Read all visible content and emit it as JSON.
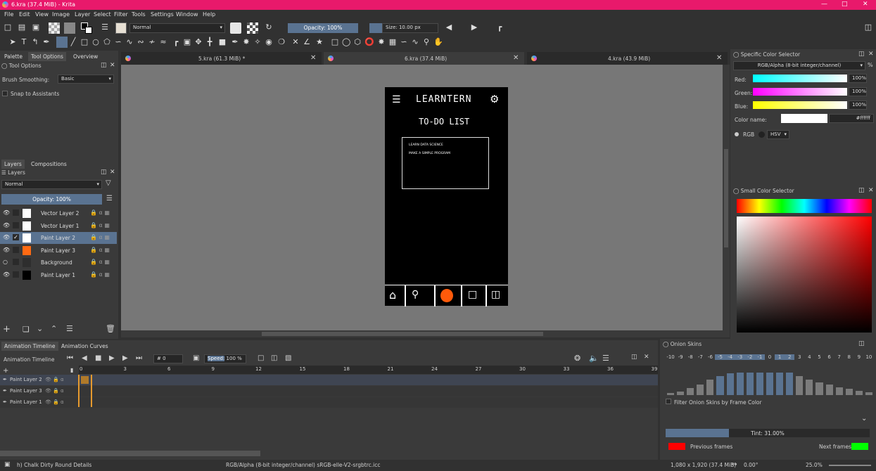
{
  "window": {
    "title": "6.kra (37.4 MiB)  - Krita"
  },
  "menu": [
    "File",
    "Edit",
    "View",
    "Image",
    "Layer",
    "Select",
    "Filter",
    "Tools",
    "Settings",
    "Window",
    "Help"
  ],
  "toolbar": {
    "blend_mode": "Normal",
    "opacity": "Opacity: 100%",
    "size": "Size: 10.00 px"
  },
  "left_tabs": [
    "Palette",
    "Tool Options",
    "Overview"
  ],
  "tool_options": {
    "title": "Tool Options",
    "brush_smoothing_label": "Brush Smoothing:",
    "brush_smoothing_value": "Basic",
    "snap_label": "Snap to Assistants"
  },
  "layers_tabs": [
    "Layers",
    "Compositions"
  ],
  "layers": {
    "title": "Layers",
    "blend": "Normal",
    "opacity": "Opacity:  100%",
    "items": [
      {
        "name": "Vector Layer 2",
        "thumb": "#ffffff",
        "selected": false,
        "visible": true
      },
      {
        "name": "Vector Layer 1",
        "thumb": "#ffffff",
        "selected": false,
        "visible": true
      },
      {
        "name": "Paint Layer 2",
        "thumb": "#ffffff",
        "selected": true,
        "visible": true
      },
      {
        "name": "Paint Layer 3",
        "thumb": "#ff6a13",
        "selected": false,
        "visible": true
      },
      {
        "name": "Background",
        "thumb": "#2e2e2e",
        "selected": false,
        "visible": false
      },
      {
        "name": "Paint Layer 1",
        "thumb": "#000000",
        "selected": false,
        "visible": true
      }
    ]
  },
  "doc_tabs": [
    {
      "name": "5.kra (61.3 MiB) *"
    },
    {
      "name": "6.kra (37.4 MiB)"
    },
    {
      "name": "4.kra (43.9 MiB)"
    }
  ],
  "canvas": {
    "app_title": "LEARNTERN",
    "heading": "TO-DO LIST",
    "items": [
      "LEARN DATA SCIENCE",
      "MAKE A SIMPLE PROGRAM"
    ]
  },
  "specific_color": {
    "title": "Specific Color Selector",
    "model": "RGB/Alpha (8-bit integer/channel)",
    "pct": "%",
    "red_label": "Red:",
    "red_val": "100%",
    "green_label": "Green:",
    "green_val": "100%",
    "blue_label": "Blue:",
    "blue_val": "100%",
    "colorname_label": "Color name:",
    "hex": "#ffffff",
    "rgb": "RGB",
    "hsv": "HSV"
  },
  "small_color": {
    "title": "Small Color Selector"
  },
  "anim_tabs": [
    "Animation Timeline",
    "Animation Curves"
  ],
  "timeline": {
    "title": "Animation Timeline",
    "frame": "0",
    "speed_label": "Speed:",
    "speed": "100 %",
    "ruler": [
      "0",
      "3",
      "6",
      "9",
      "12",
      "15",
      "18",
      "21",
      "24",
      "27",
      "30",
      "33",
      "36",
      "39"
    ],
    "rows": [
      "Paint Layer 2",
      "Paint Layer 3",
      "Paint Layer 1"
    ]
  },
  "onion": {
    "title": "Onion Skins",
    "nums": [
      "-10",
      "-9",
      "-8",
      "-7",
      "-6",
      "-5",
      "-4",
      "-3",
      "-2",
      "-1",
      "0",
      "1",
      "2",
      "3",
      "4",
      "5",
      "6",
      "7",
      "8",
      "9",
      "10"
    ],
    "levels": [
      0.06,
      0.12,
      0.22,
      0.34,
      0.5,
      0.62,
      0.7,
      0.72,
      0.72,
      0.72,
      0.72,
      0.72,
      0.72,
      0.62,
      0.5,
      0.4,
      0.33,
      0.25,
      0.2,
      0.14,
      0.1
    ],
    "filter": "Filter Onion Skins by Frame Color",
    "tint": "Tint: 31.00%",
    "tint_level": 0.31,
    "prev": "Previous frames",
    "next": "Next frames",
    "prev_color": "#ff0000",
    "next_color": "#00ff00"
  },
  "status": {
    "brush": "h) Chalk Dirty Round Details",
    "colorspace": "RGB/Alpha (8-bit integer/channel)  sRGB-elle-V2-srgbtrc.icc",
    "dims": "1,080 x 1,920 (37.4 MiB)",
    "rotation": "0.00°",
    "zoom": "25.0%"
  }
}
